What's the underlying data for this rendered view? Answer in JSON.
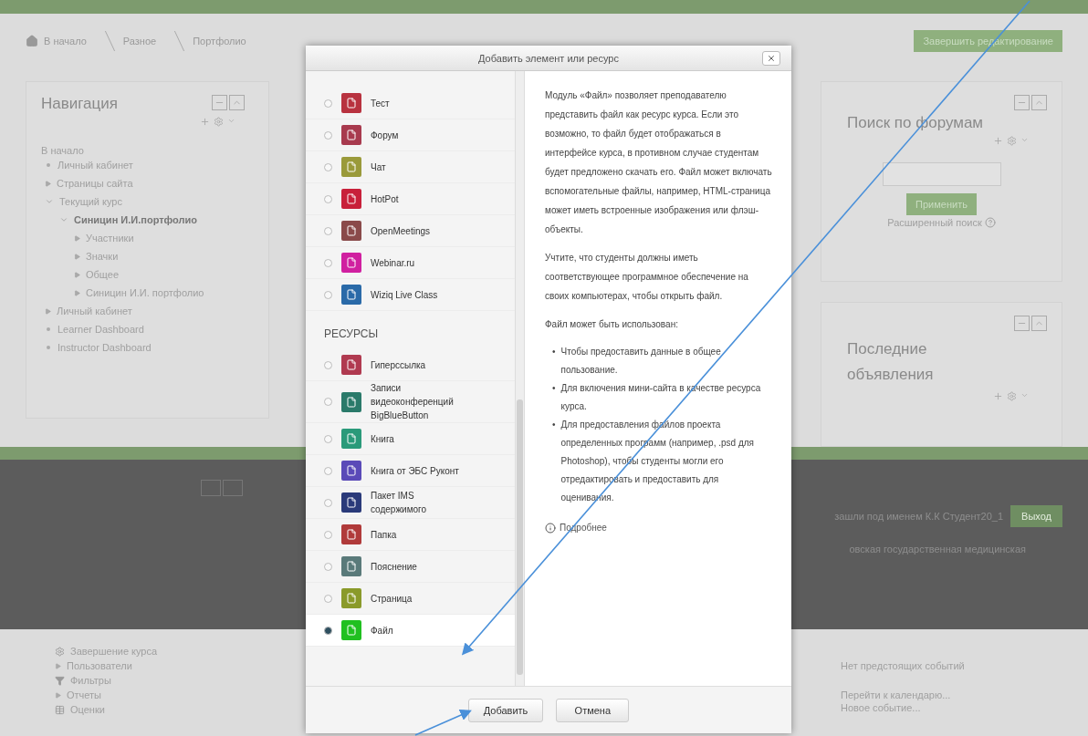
{
  "breadcrumb": [
    {
      "label": "В начало"
    },
    {
      "label": "Разное"
    },
    {
      "label": "Портфолио"
    }
  ],
  "edit_button": "Завершить редактирование",
  "navigation": {
    "title": "Навигация",
    "root": "В начало",
    "items": [
      {
        "label": "Личный кабинет",
        "kind": "leaf"
      },
      {
        "label": "Страницы сайта",
        "kind": "branch",
        "expanded": false
      },
      {
        "label": "Текущий курс",
        "kind": "branch",
        "expanded": true,
        "children": [
          {
            "label": "Синицин И.И.портфолио",
            "kind": "branch",
            "expanded": true,
            "children": [
              {
                "label": "Участники",
                "kind": "branch",
                "expanded": false
              },
              {
                "label": "Значки",
                "kind": "branch",
                "expanded": false
              },
              {
                "label": "Общее",
                "kind": "branch",
                "expanded": false
              },
              {
                "label": "Синицин И.И. портфолио",
                "kind": "branch",
                "expanded": false
              }
            ]
          }
        ]
      },
      {
        "label": "Личный кабинет",
        "kind": "branch",
        "expanded": false
      },
      {
        "label": "Learner Dashboard",
        "kind": "leaf"
      },
      {
        "label": "Instructor Dashboard",
        "kind": "leaf"
      }
    ]
  },
  "forum_search": {
    "title": "Поиск по форумам",
    "button": "Применить",
    "advanced": "Расширенный поиск"
  },
  "announcements": {
    "title": "Последние объявления"
  },
  "footer": {
    "login_text": "зашли под именем К.К Студент20_1",
    "logout": "Выход",
    "org": "овская государственная медицинская"
  },
  "admin_items": [
    {
      "label": "Завершение курса",
      "kind": "gear"
    },
    {
      "label": "Пользователи",
      "kind": "arrow"
    },
    {
      "label": "Фильтры",
      "kind": "filter"
    },
    {
      "label": "Отчеты",
      "kind": "arrow"
    },
    {
      "label": "Оценки",
      "kind": "table"
    }
  ],
  "calendar": {
    "empty": "Нет предстоящих событий",
    "links": [
      "Перейти к календарю...",
      "Новое событие..."
    ]
  },
  "dialog": {
    "title": "Добавить элемент или ресурс",
    "items": [
      {
        "kind": "module",
        "label": "Тест",
        "color": "#b8323f",
        "selected": false
      },
      {
        "kind": "module",
        "label": "Форум",
        "color": "#a83a4e",
        "selected": false
      },
      {
        "kind": "module",
        "label": "Чат",
        "color": "#9a9a3a",
        "selected": false
      },
      {
        "kind": "module",
        "label": "HotPot",
        "color": "#c8203a",
        "selected": false
      },
      {
        "kind": "module",
        "label": "OpenMeetings",
        "color": "#8a4a4a",
        "selected": false
      },
      {
        "kind": "module",
        "label": "Webinar.ru",
        "color": "#d020a0",
        "selected": false
      },
      {
        "kind": "module",
        "label": "Wiziq Live Class",
        "color": "#2a6aa8",
        "selected": false
      },
      {
        "kind": "heading",
        "label": "РЕСУРСЫ"
      },
      {
        "kind": "module",
        "label": "Гиперссылка",
        "color": "#b03a50",
        "selected": false
      },
      {
        "kind": "module",
        "label": "Записи видеоконференций BigBlueButton",
        "color": "#2a7a6a",
        "selected": false
      },
      {
        "kind": "module",
        "label": "Книга",
        "color": "#2a9a7a",
        "selected": false
      },
      {
        "kind": "module",
        "label": "Книга от ЭБС Руконт",
        "color": "#5a4ab8",
        "selected": false
      },
      {
        "kind": "module",
        "label": "Пакет IMS содержимого",
        "color": "#2a3a7a",
        "selected": false
      },
      {
        "kind": "module",
        "label": "Папка",
        "color": "#b03a3a",
        "selected": false
      },
      {
        "kind": "module",
        "label": "Пояснение",
        "color": "#5a7a7a",
        "selected": false
      },
      {
        "kind": "module",
        "label": "Страница",
        "color": "#8a9a2a",
        "selected": false
      },
      {
        "kind": "module",
        "label": "Файл",
        "color": "#20c020",
        "selected": true
      }
    ],
    "description": {
      "paragraphs": [
        "Модуль «Файл» позволяет преподавателю представить файл как ресурс курса. Если это возможно, то файл будет отображаться в интерфейсе курса, в противном случае студентам будет предложено скачать его. Файл может включать вспомогательные файлы, например, HTML-страница может иметь встроенные изображения или флэш-объекты.",
        "Учтите, что студенты должны иметь соответствующее программное обеспечение на своих компьютерах, чтобы открыть файл.",
        "Файл может быть использован:"
      ],
      "bullets": [
        {
          "marker": "•",
          "text": "Чтобы предоставить данные в общее пользование."
        },
        {
          "marker": "•",
          "text": "Для включения мини-сайта в качестве ресурса курса."
        },
        {
          "marker": "•",
          "text": "Для предоставления файлов проекта определенных программ (например, .psd для Photoshop), чтобы студенты могли его отредактировать и предоставить для оценивания."
        }
      ],
      "more": "Подробнее"
    },
    "buttons": [
      {
        "label": "Добавить"
      },
      {
        "label": "Отмена"
      }
    ]
  }
}
